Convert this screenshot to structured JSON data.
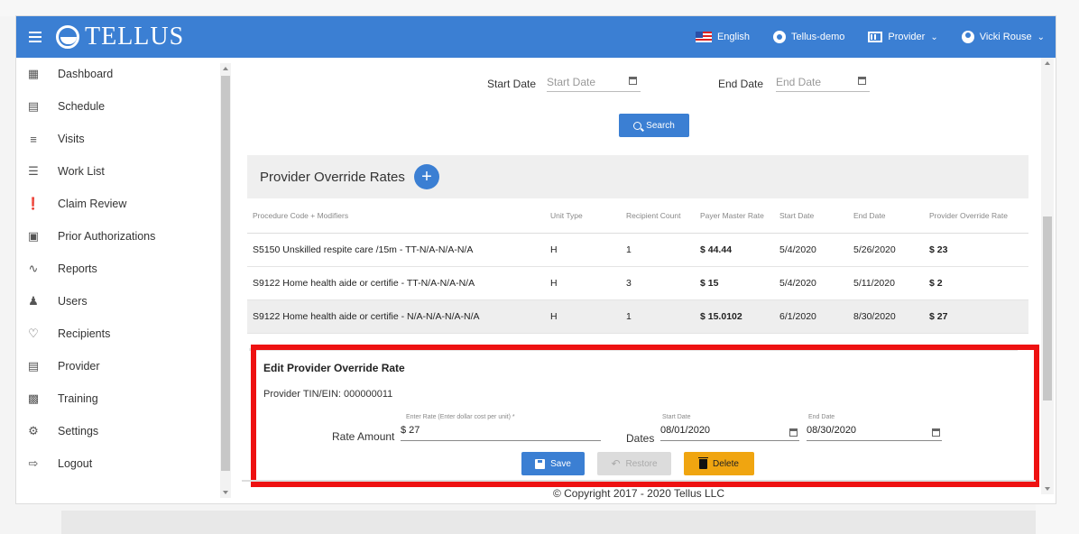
{
  "header": {
    "logo_text": "TELLUS",
    "language": "English",
    "account": "Tellus-demo",
    "role": "Provider",
    "user": "Vicki Rouse"
  },
  "sidebar": {
    "items": [
      {
        "label": "Dashboard",
        "icon": "dashboard-icon"
      },
      {
        "label": "Schedule",
        "icon": "calendar-icon"
      },
      {
        "label": "Visits",
        "icon": "filter-icon"
      },
      {
        "label": "Work List",
        "icon": "list-icon"
      },
      {
        "label": "Claim Review",
        "icon": "alert-icon"
      },
      {
        "label": "Prior Authorizations",
        "icon": "calendar-check-icon"
      },
      {
        "label": "Reports",
        "icon": "trend-icon"
      },
      {
        "label": "Users",
        "icon": "users-icon"
      },
      {
        "label": "Recipients",
        "icon": "recipients-icon"
      },
      {
        "label": "Provider",
        "icon": "clipboard-icon"
      },
      {
        "label": "Training",
        "icon": "training-icon"
      },
      {
        "label": "Settings",
        "icon": "gear-icon"
      },
      {
        "label": "Logout",
        "icon": "logout-icon"
      }
    ]
  },
  "filters": {
    "start_label": "Start Date",
    "start_placeholder": "Start Date",
    "end_label": "End Date",
    "end_placeholder": "End Date",
    "search_label": "Search"
  },
  "rates": {
    "title": "Provider Override Rates",
    "add_label": "+",
    "columns": [
      "Procedure Code + Modifiers",
      "Unit Type",
      "Recipient Count",
      "Payer Master Rate",
      "Start Date",
      "End Date",
      "Provider Override Rate"
    ],
    "rows": [
      {
        "code": "S5150 Unskilled respite care /15m",
        "mods": "TT-N/A-N/A-N/A",
        "unit": "H",
        "count": "1",
        "payer": "$ 44.44",
        "start": "5/4/2020",
        "end": "5/26/2020",
        "override": "$ 23"
      },
      {
        "code": "S9122 Home health aide or certifie",
        "mods": "TT-N/A-N/A-N/A",
        "unit": "H",
        "count": "3",
        "payer": "$ 15",
        "start": "5/4/2020",
        "end": "5/11/2020",
        "override": "$ 2"
      },
      {
        "code": "S9122 Home health aide or certifie",
        "mods": "N/A-N/A-N/A-N/A",
        "unit": "H",
        "count": "1",
        "payer": "$ 15.0102",
        "start": "6/1/2020",
        "end": "8/30/2020",
        "override": "$ 27"
      }
    ]
  },
  "edit": {
    "title": "Edit Provider Override Rate",
    "tin": "Provider TIN/EIN: 000000011",
    "rate_hint": "Enter Rate (Enter dollar cost per unit) *",
    "rate_label": "Rate Amount",
    "rate_value": "$ 27",
    "dates_label": "Dates",
    "start_hint": "Start Date",
    "start_value": "08/01/2020",
    "end_hint": "End Date",
    "end_value": "08/30/2020",
    "save_label": "Save",
    "restore_label": "Restore",
    "delete_label": "Delete"
  },
  "footer": {
    "copyright": "© Copyright 2017 - 2020 Tellus LLC"
  },
  "colors": {
    "primary": "#3b7fd3",
    "warning": "#f0a510",
    "highlight": "#ee1111"
  }
}
